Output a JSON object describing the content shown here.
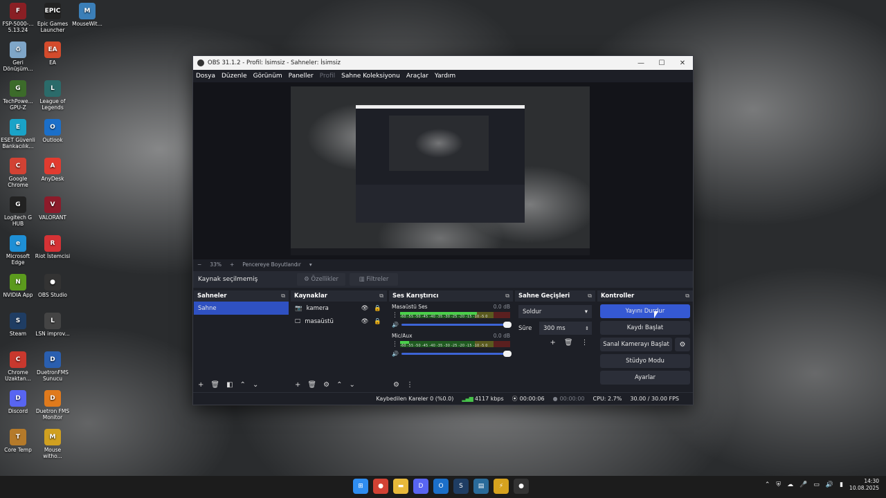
{
  "desktop_icons": [
    {
      "label": "FSP-5000-... 5.13.24",
      "color": "#8a1f24",
      "glyph": "F"
    },
    {
      "label": "Epic Games Launcher",
      "color": "#222",
      "glyph": "EPIC"
    },
    {
      "label": "MouseWit...",
      "color": "#3b7fb8",
      "glyph": "M"
    },
    {
      "label": "Geri Dönüşüm...",
      "color": "#7fa6c8",
      "glyph": "♻"
    },
    {
      "label": "EA",
      "color": "#d44b2c",
      "glyph": "EA"
    },
    {
      "label": "TechPowe... GPU-Z",
      "color": "#3c6b2a",
      "glyph": "G"
    },
    {
      "label": "League of Legends",
      "color": "#2b6b6a",
      "glyph": "L"
    },
    {
      "label": "ESET Güvenli Bankacılık...",
      "color": "#1aa3c8",
      "glyph": "E"
    },
    {
      "label": "Outlook",
      "color": "#1b6fc9",
      "glyph": "O"
    },
    {
      "label": "Google Chrome",
      "color": "#d24234",
      "glyph": "C"
    },
    {
      "label": "AnyDesk",
      "color": "#e23b2f",
      "glyph": "A"
    },
    {
      "label": "Logitech G HUB",
      "color": "#222",
      "glyph": "G"
    },
    {
      "label": "VALORANT",
      "color": "#8c1b2a",
      "glyph": "V"
    },
    {
      "label": "Microsoft Edge",
      "color": "#1e8fd5",
      "glyph": "e"
    },
    {
      "label": "Riot İstemcisi",
      "color": "#d53235",
      "glyph": "R"
    },
    {
      "label": "NVIDIA App",
      "color": "#5b9a1d",
      "glyph": "N"
    },
    {
      "label": "OBS Studio",
      "color": "#333",
      "glyph": "●"
    },
    {
      "label": "Steam",
      "color": "#1f3d63",
      "glyph": "S"
    },
    {
      "label": "LSN improv...",
      "color": "#444",
      "glyph": "L"
    },
    {
      "label": "Chrome Uzaktan...",
      "color": "#c8382e",
      "glyph": "C"
    },
    {
      "label": "DuetronFMS Sunucu",
      "color": "#2a5fb0",
      "glyph": "D"
    },
    {
      "label": "Discord",
      "color": "#5865f2",
      "glyph": "D"
    },
    {
      "label": "Duetron FMS Monitor",
      "color": "#e07a1c",
      "glyph": "D"
    },
    {
      "label": "Core Temp",
      "color": "#b57a2a",
      "glyph": "T"
    },
    {
      "label": "Mouse witho...",
      "color": "#d0a020",
      "glyph": "M"
    }
  ],
  "obs": {
    "window_title": "OBS 31.1.2 - Profil: İsimsiz - Sahneler: İsimsiz",
    "window_buttons": {
      "minimize": "—",
      "maximize": "☐",
      "close": "✕"
    },
    "menu": [
      "Dosya",
      "Düzenle",
      "Görünüm",
      "Paneller",
      "Profil",
      "Sahne Koleksiyonu",
      "Araçlar",
      "Yardım"
    ],
    "menu_disabled": "Profil",
    "zoom": {
      "minus": "−",
      "level": "33%",
      "plus": "+",
      "fit_label": "Pencereye Boyutlandır",
      "caret": "▾"
    },
    "source_bar": {
      "none_selected": "Kaynak seçilmemiş",
      "properties": "Özellikler",
      "filters": "Filtreler"
    },
    "scenes": {
      "title": "Sahneler",
      "items": [
        "Sahne"
      ]
    },
    "sources": {
      "title": "Kaynaklar",
      "items": [
        {
          "icon": "camera",
          "name": "kamera"
        },
        {
          "icon": "monitor",
          "name": "masaüstü"
        }
      ]
    },
    "mixer": {
      "title": "Ses Karıştırıcı",
      "tracks": [
        {
          "name": "Masaüstü Ses",
          "db": "0.0 dB",
          "level": 0.7
        },
        {
          "name": "Mic/Aux",
          "db": "0.0 dB",
          "level": 0.08
        }
      ],
      "scale": "-60 -55 -50 -45 -40 -35 -30 -25 -20 -15 -10 -5 0"
    },
    "transitions": {
      "title": "Sahne Geçişleri",
      "type": "Soldur",
      "duration_label": "Süre",
      "duration": "300 ms"
    },
    "controls": {
      "title": "Kontroller",
      "stop_stream": "Yayını Durdur",
      "start_record": "Kaydı Başlat",
      "virtual_cam": "Sanal Kamerayı Başlat",
      "studio_mode": "Stüdyo Modu",
      "settings": "Ayarlar"
    },
    "status": {
      "dropped": "Kaybedilen Kareler 0 (%0.0)",
      "bitrate": "4117 kbps",
      "stream_time": "00:00:06",
      "record_time": "00:00:00",
      "cpu": "CPU: 2.7%",
      "fps": "30.00 / 30.00 FPS"
    }
  },
  "taskbar": {
    "apps": [
      {
        "name": "start",
        "color": "#2f8df0",
        "glyph": "⊞"
      },
      {
        "name": "chrome",
        "color": "#d24234",
        "glyph": "●"
      },
      {
        "name": "explorer",
        "color": "#e8b93a",
        "glyph": "▬"
      },
      {
        "name": "discord",
        "color": "#5865f2",
        "glyph": "D"
      },
      {
        "name": "outlook",
        "color": "#1b6fc9",
        "glyph": "O"
      },
      {
        "name": "steam",
        "color": "#1f3d63",
        "glyph": "S"
      },
      {
        "name": "app-blue",
        "color": "#2a6b9a",
        "glyph": "▤"
      },
      {
        "name": "app-yellow",
        "color": "#d6a21e",
        "glyph": "⚡"
      },
      {
        "name": "obs",
        "color": "#333",
        "glyph": "●"
      }
    ],
    "tray": {
      "chevron": "⌃",
      "icons": [
        "⛨",
        "☁",
        "🎤"
      ],
      "time": "14:30",
      "date": "10.08.2025"
    }
  }
}
